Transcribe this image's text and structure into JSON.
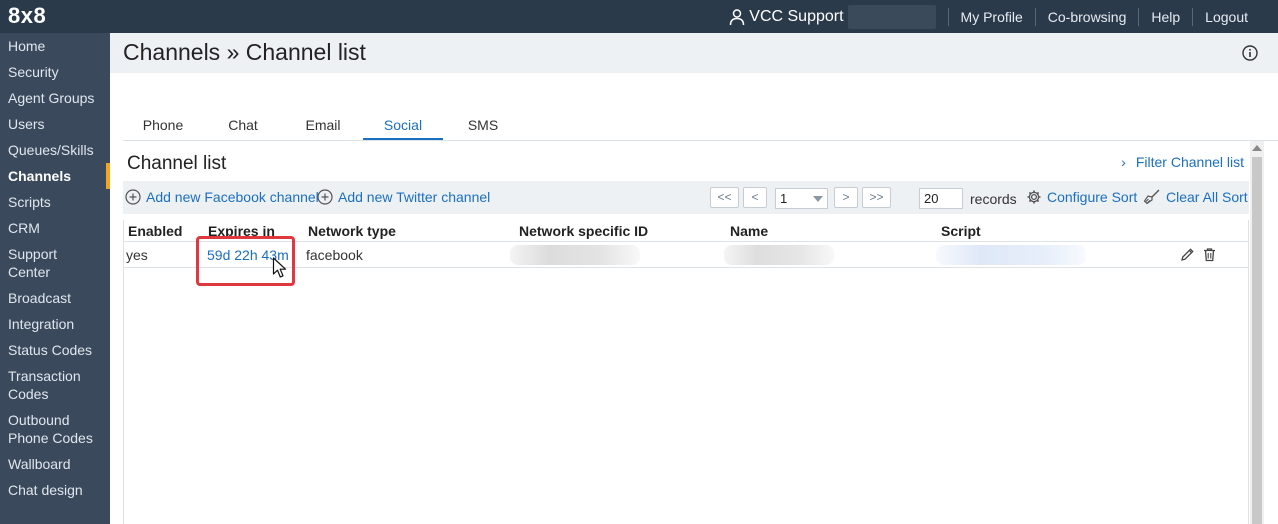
{
  "app": {
    "logo": "8x8"
  },
  "topnav": {
    "user_name": "VCC Support",
    "links": [
      "My Profile",
      "Co-browsing",
      "Help",
      "Logout"
    ]
  },
  "sidebar": {
    "items": [
      {
        "label": "Home"
      },
      {
        "label": "Security"
      },
      {
        "label": "Agent Groups"
      },
      {
        "label": "Users"
      },
      {
        "label": "Queues/Skills"
      },
      {
        "label": "Channels",
        "active": true
      },
      {
        "label": "Scripts"
      },
      {
        "label": "CRM"
      },
      {
        "label": "Support Center"
      },
      {
        "label": "Broadcast"
      },
      {
        "label": "Integration"
      },
      {
        "label": "Status Codes"
      },
      {
        "label": "Transaction Codes"
      },
      {
        "label": "Outbound Phone Codes"
      },
      {
        "label": "Wallboard"
      },
      {
        "label": "Chat design"
      }
    ]
  },
  "header": {
    "title": "Channels » Channel list"
  },
  "tabs": [
    {
      "label": "Phone"
    },
    {
      "label": "Chat"
    },
    {
      "label": "Email"
    },
    {
      "label": "Social",
      "active": true
    },
    {
      "label": "SMS"
    }
  ],
  "section": {
    "title": "Channel list",
    "filter_label": "Filter Channel list"
  },
  "toolbar": {
    "add_facebook": "Add new Facebook channel",
    "add_twitter": "Add new Twitter channel",
    "first": "<<",
    "prev": "<",
    "page": "1",
    "next": ">",
    "last": ">>",
    "records_value": "20",
    "records_label": "records",
    "configure_sort": "Configure Sort",
    "clear_sort": "Clear All Sort"
  },
  "table": {
    "columns": [
      "Enabled",
      "Expires in",
      "Network type",
      "Network specific ID",
      "Name",
      "Script"
    ],
    "rows": [
      {
        "enabled": "yes",
        "expires_in": "59d 22h 43m",
        "network_type": "facebook"
      }
    ]
  },
  "colors": {
    "topbar": "#2b3a4b",
    "sidebar": "#3a4a5c",
    "accent": "#1a6fc1",
    "active_marker": "#f4a51c",
    "highlight": "#e0383e"
  }
}
